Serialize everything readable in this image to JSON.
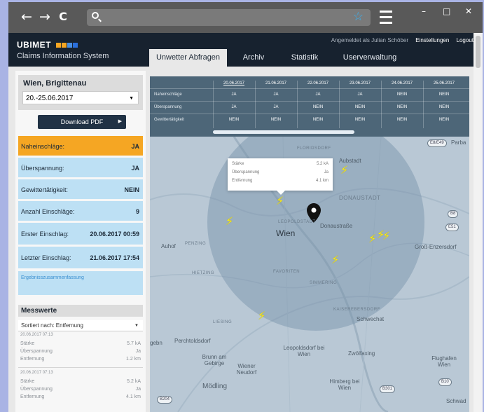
{
  "browser": {
    "back": "←",
    "forward": "→",
    "reload": "C",
    "url_value": "",
    "star": "☆",
    "win_min": "–",
    "win_max": "□",
    "win_close": "✕"
  },
  "header": {
    "brand": "UBIMET",
    "brand_squares": [
      "#f5a623",
      "#f5a623",
      "#4a90e2",
      "#2a6fdb"
    ],
    "subtitle": "Claims Information System",
    "logged_in": "Angemeldet als Julian Schöber",
    "settings": "Einstellungen",
    "logout": "Logout",
    "tabs": [
      "Unwetter Abfragen",
      "Archiv",
      "Statistik",
      "Userverwaltung"
    ]
  },
  "left": {
    "location_title": "Wien, Brigittenau",
    "date_range": "20.-25.06.2017",
    "download_pdf": "Download PDF",
    "stats": [
      {
        "label": "Naheinschläge:",
        "value": "JA"
      },
      {
        "label": "Überspannung:",
        "value": "JA"
      },
      {
        "label": "Gewittertätigkeit:",
        "value": "NEIN"
      },
      {
        "label": "Anzahl Einschläge:",
        "value": "9"
      },
      {
        "label": "Erster Einschlag:",
        "value": "20.06.2017 00:59"
      },
      {
        "label": "Letzter Einschlag:",
        "value": "21.06.2017 17:54"
      }
    ],
    "summary_link": "Ergebnisszusammenfassung",
    "measurements_title": "Messwerte",
    "sort_label": "Sortiert nach: Entfernung",
    "entries": [
      {
        "datetime": "20.06.2017 07:13",
        "staerke": "5.7 kA",
        "ueberspannung": "Ja",
        "entfernung": "1.2 km"
      },
      {
        "datetime": "20.06.2017 07:13",
        "staerke": "5.2 kA",
        "ueberspannung": "Ja",
        "entfernung": "4.1 km"
      }
    ],
    "entry_labels": {
      "staerke": "Stärke",
      "ueberspannung": "Überspannung",
      "entfernung": "Entfernung"
    }
  },
  "table": {
    "dates": [
      "20.06.2017",
      "21.06.2017",
      "22.06.2017",
      "23.06.2017",
      "24.06.2017",
      "25.06.2017"
    ],
    "rows": [
      {
        "label": "Naheinschläge",
        "values": [
          "JA",
          "JA",
          "JA",
          "JA",
          "NEIN",
          "NEIN"
        ]
      },
      {
        "label": "Überspannung",
        "values": [
          "JA",
          "JA",
          "NEIN",
          "NEIN",
          "NEIN",
          "NEIN"
        ]
      },
      {
        "label": "Gewittertätigkeit",
        "values": [
          "NEIN",
          "NEIN",
          "NEIN",
          "NEIN",
          "NEIN",
          "NEIN"
        ]
      }
    ]
  },
  "map": {
    "tooltip": {
      "staerke_label": "Stärke",
      "staerke": "5.2 kA",
      "ueber_label": "Überspannung",
      "ueber": "Ja",
      "entf_label": "Entfernung",
      "entf": "4.1 km"
    },
    "labels": {
      "floridsdorf": "FLORIDSDORF",
      "donaustadt": "DONAUSTADT",
      "leopoldstadt": "LEOPOLDSTADT",
      "wien": "Wien",
      "donaustrasse": "Donaustraße",
      "grossenzersdorf": "Groß-Enzersdorf",
      "penzing": "PENZING",
      "hietzing": "HIETZING",
      "favoriten": "FAVORITEN",
      "simmering": "SIMMERING",
      "kaiserebersdorf": "KAISEREBERSDORF",
      "schwechat": "Schwechat",
      "liesing": "LIESING",
      "perchtoldsdorf": "Perchtoldsdorf",
      "brunn": "Brunn am Gebirge",
      "leopoldsdorf": "Leopoldsdorf bei Wien",
      "zwoelfaxing": "Zwölfaxing",
      "flughafen": "Flughafen Wien",
      "wiener_neudorf": "Wiener Neudorf",
      "moedling": "Mödling",
      "himberg": "Himberg bei Wien",
      "parbasdorf": "Parba",
      "aubstadt": "Aubstadt",
      "auhof": "Auhof",
      "gebn": "gebn",
      "schwad": "Schwad"
    },
    "signs": [
      "E8/E49",
      "B8",
      "E51",
      "B301",
      "B10",
      "B204"
    ]
  }
}
